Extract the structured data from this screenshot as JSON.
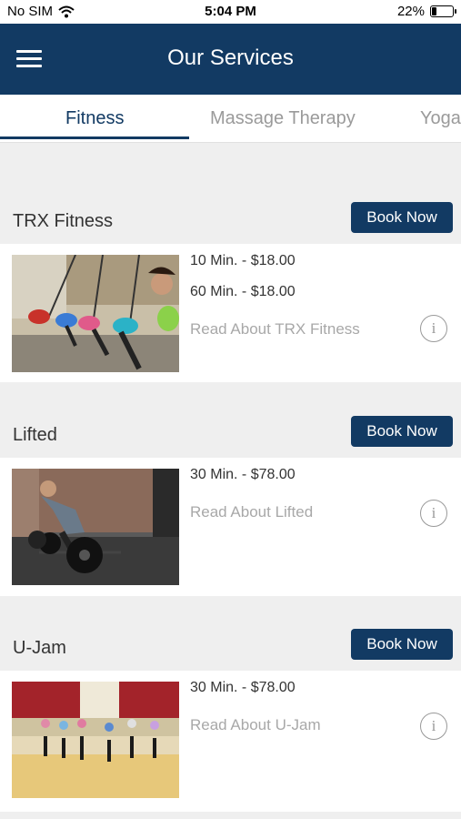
{
  "status": {
    "carrier": "No SIM",
    "time": "5:04 PM",
    "battery": "22%"
  },
  "header": {
    "title": "Our Services"
  },
  "tabs": [
    {
      "label": "Fitness",
      "active": true
    },
    {
      "label": "Massage Therapy",
      "active": false
    },
    {
      "label": "Yoga",
      "active": false
    }
  ],
  "services": [
    {
      "name": "TRX Fitness",
      "book_label": "Book Now",
      "prices": [
        "10 Min. - $18.00",
        "60 Min. - $18.00"
      ],
      "read_more": "Read About TRX Fitness"
    },
    {
      "name": "Lifted",
      "book_label": "Book Now",
      "prices": [
        "30 Min. - $78.00"
      ],
      "read_more": "Read About Lifted"
    },
    {
      "name": "U-Jam",
      "book_label": "Book Now",
      "prices": [
        "30 Min. - $78.00"
      ],
      "read_more": "Read About U-Jam"
    }
  ],
  "colors": {
    "brand": "#123a63",
    "background": "#efefef"
  }
}
